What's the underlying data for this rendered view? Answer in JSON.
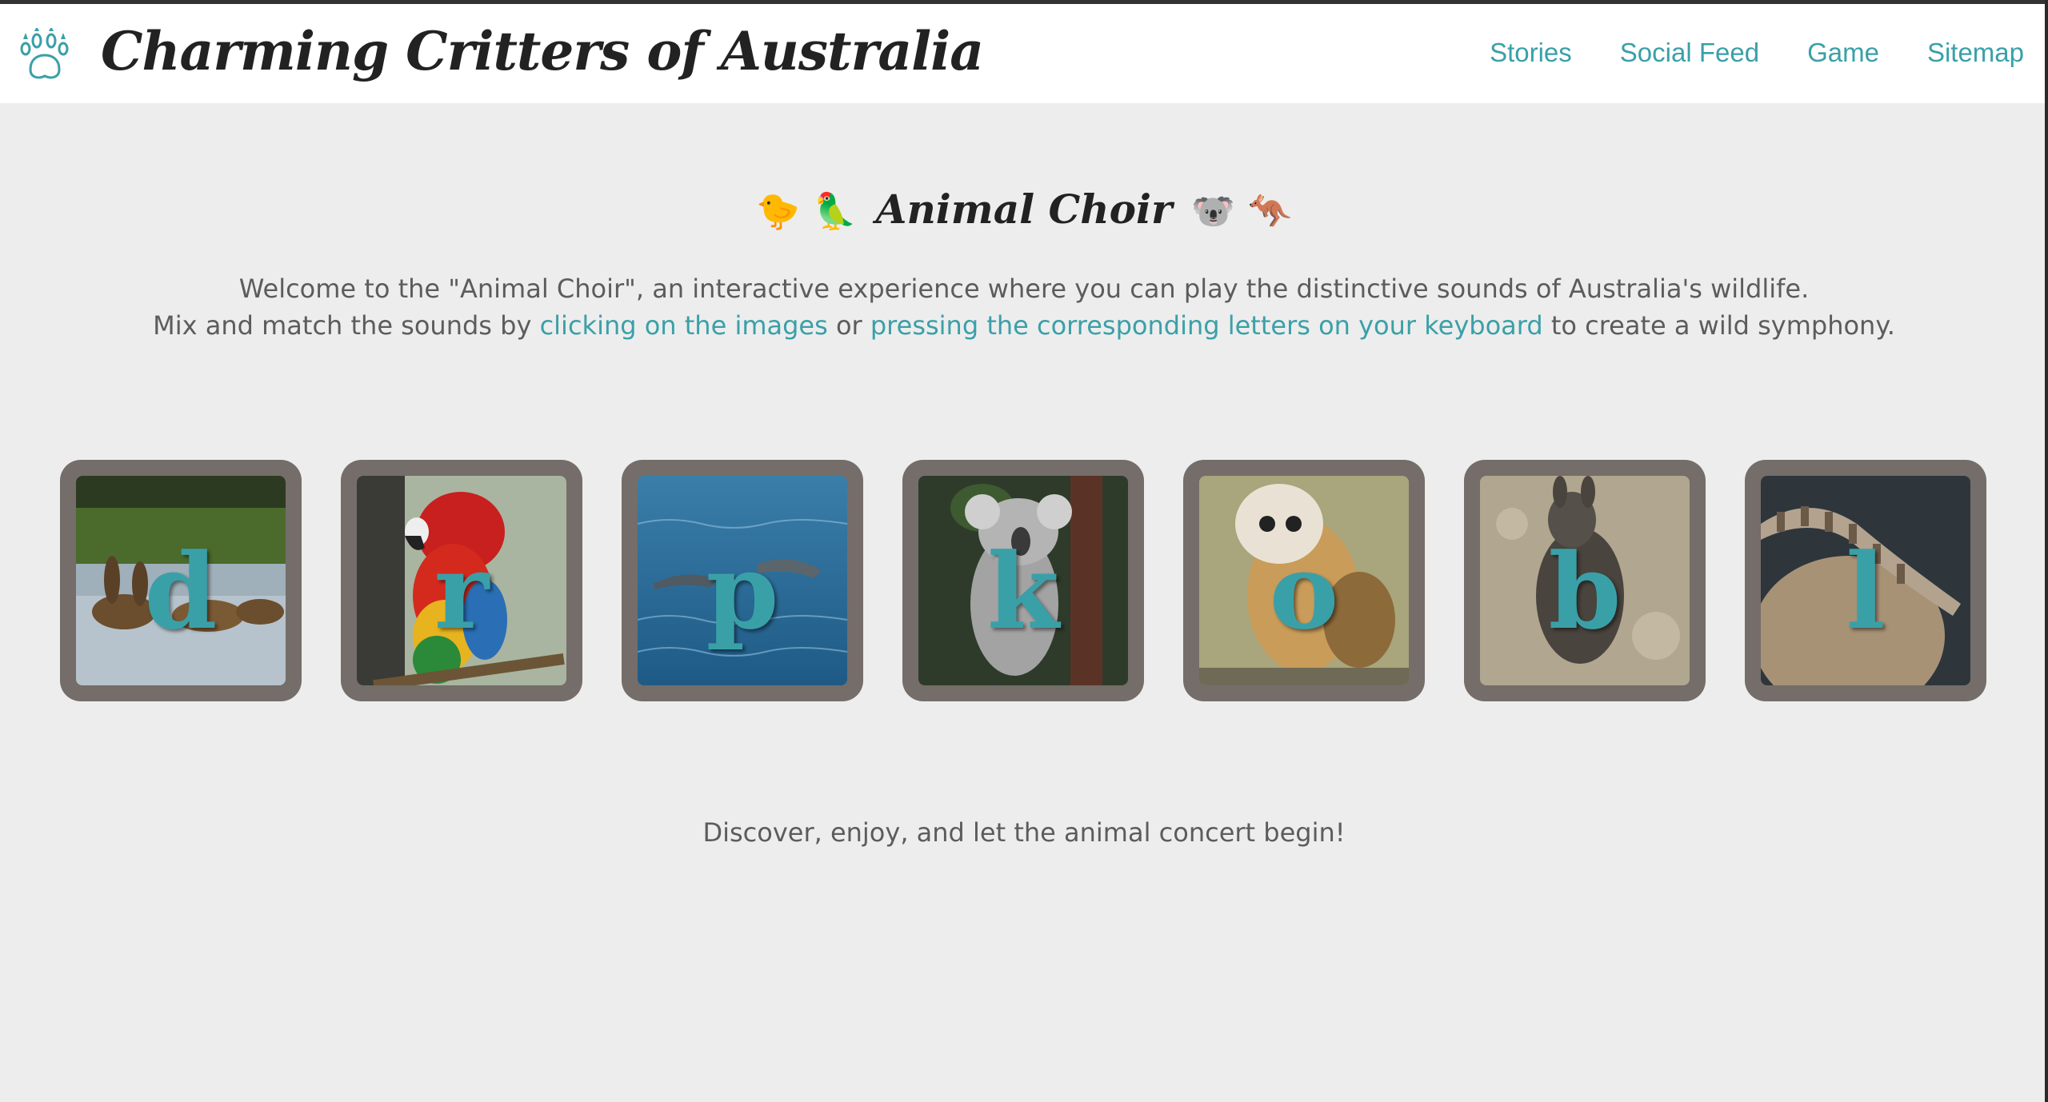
{
  "header": {
    "site_title": "Charming Critters of Australia",
    "logo_icon": "paw-print-icon",
    "nav": [
      {
        "label": "Stories"
      },
      {
        "label": "Social Feed"
      },
      {
        "label": "Game"
      },
      {
        "label": "Sitemap"
      }
    ]
  },
  "main": {
    "title": "Animal Choir",
    "title_emojis_left": [
      "🐤",
      "🦜"
    ],
    "title_emojis_right": [
      "🐨",
      "🦘"
    ],
    "intro_line1": "Welcome to the \"Animal Choir\", an interactive experience where you can play the distinctive sounds of Australia's wildlife.",
    "intro_line2_a": "Mix and match the sounds by ",
    "intro_line2_link1": "clicking on the images",
    "intro_line2_b": " or ",
    "intro_line2_link2": "pressing the corresponding letters on your keyboard",
    "intro_line2_c": " to create a wild symphony.",
    "tiles": [
      {
        "letter": "d",
        "animal": "duck"
      },
      {
        "letter": "r",
        "animal": "parrot"
      },
      {
        "letter": "p",
        "animal": "dolphin"
      },
      {
        "letter": "k",
        "animal": "koala"
      },
      {
        "letter": "o",
        "animal": "owl"
      },
      {
        "letter": "b",
        "animal": "wallaby"
      },
      {
        "letter": "l",
        "animal": "lizard"
      }
    ],
    "closing": "Discover, enjoy, and let the animal concert begin!"
  },
  "colors": {
    "accent": "#3aa0a8",
    "tile_frame": "#746d69",
    "background": "#ededed"
  }
}
